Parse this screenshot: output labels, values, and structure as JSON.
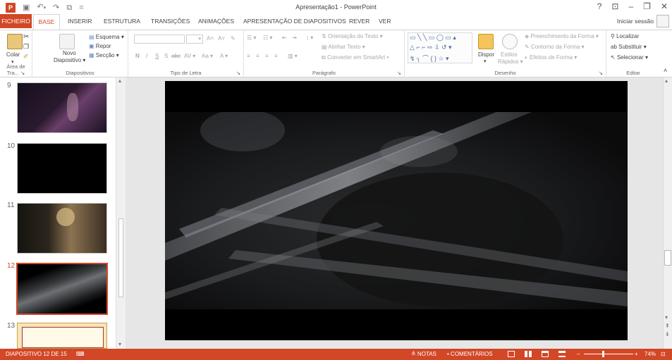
{
  "window": {
    "title": "Apresentação1 - PowerPoint",
    "help": "?",
    "ribbon_opts": "⊡",
    "minimize": "–",
    "restore": "❐",
    "close": "✕",
    "signin": "Iniciar sessão"
  },
  "qat": {
    "logo": "P",
    "save": "▣",
    "undo": "↶",
    "undo_arrow": "▾",
    "redo": "↷",
    "present": "⧉",
    "customize": "="
  },
  "tabs": {
    "file": "FICHEIRO",
    "home": "BASE",
    "insert": "INSERIR",
    "design": "ESTRUTURA",
    "transitions": "TRANSIÇÕES",
    "animations": "ANIMAÇÕES",
    "slideshow": "APRESENTAÇÃO DE DIAPOSITIVOS",
    "review": "REVER",
    "view": "VER"
  },
  "ribbon": {
    "clipboard": {
      "label": "Área de Tra...",
      "paste": "Colar",
      "paste_arrow": "▾"
    },
    "slides": {
      "label": "Diapositivos",
      "new_slide_1": "Novo",
      "new_slide_2": "Diapositivo ▾",
      "layout": "Esquema ▾",
      "reset": "Repor",
      "section": "Secção ▾"
    },
    "font": {
      "label": "Tipo de Letra",
      "size_arrow": "▾",
      "grow": "A˄",
      "shrink": "A˅",
      "clear": "✎",
      "bold": "N",
      "italic": "I",
      "underline": "S",
      "shadow": "S",
      "strike": "abc",
      "spacing": "AV ▾",
      "case": "Aa ▾",
      "color": "A ▾"
    },
    "paragraph": {
      "label": "Parágrafo",
      "bullets": "☰ ▾",
      "numbering": "☷ ▾",
      "dec_indent": "⇤",
      "inc_indent": "⇥",
      "line_spacing": "↕ ▾",
      "align_left": "≡",
      "align_center": "≡",
      "align_right": "≡",
      "justify": "≡",
      "columns": "▥ ▾",
      "text_direction": "Orientação do Texto ▾",
      "align_text": "Alinhar Texto ▾",
      "smartart": "Converter em SmartArt ▾"
    },
    "drawing": {
      "label": "Desenho",
      "shapes_row1": "▭ ╲ ╲ ▭ ◯ ▭ ▴",
      "shapes_row2": "△ ⌐ ⌐ ⇨ ⇩ ↺ ▾",
      "shapes_row3": "↯ ╮ ⌒ { } ☆ ▾",
      "arrange": "Dispor",
      "arrange_arrow": "▾",
      "quick_styles_1": "Estilos",
      "quick_styles_2": "Rápidos ▾",
      "fill": "Preenchimento da Forma ▾",
      "outline": "Contorno da Forma ▾",
      "effects": "Efeitos de Forma ▾"
    },
    "editing": {
      "label": "Editar",
      "find": "Localizar",
      "replace": "Substituir ▾",
      "select": "Selecionar ▾"
    },
    "collapse": "˄",
    "launcher": "↘"
  },
  "thumbs": {
    "n9": "9",
    "n10": "10",
    "n11": "11",
    "n12": "12",
    "n13": "13"
  },
  "scroll": {
    "up": "▴",
    "down": "▾",
    "prev": "⇞",
    "next": "⇟"
  },
  "status": {
    "slide": "DIAPOSITIVO 12 DE 15",
    "spell": "⌨",
    "notes": "≜ NOTAS",
    "comments": "▪ COMENTÁRIOS",
    "zoom_minus": "–",
    "zoom_plus": "+",
    "zoom": "74%",
    "fit": "⊡"
  },
  "colors": {
    "accent": "#d24726",
    "ribbon_border": "#d4d4d4",
    "editor_bg": "#e6e6e6",
    "slide_bg": "#000000"
  }
}
